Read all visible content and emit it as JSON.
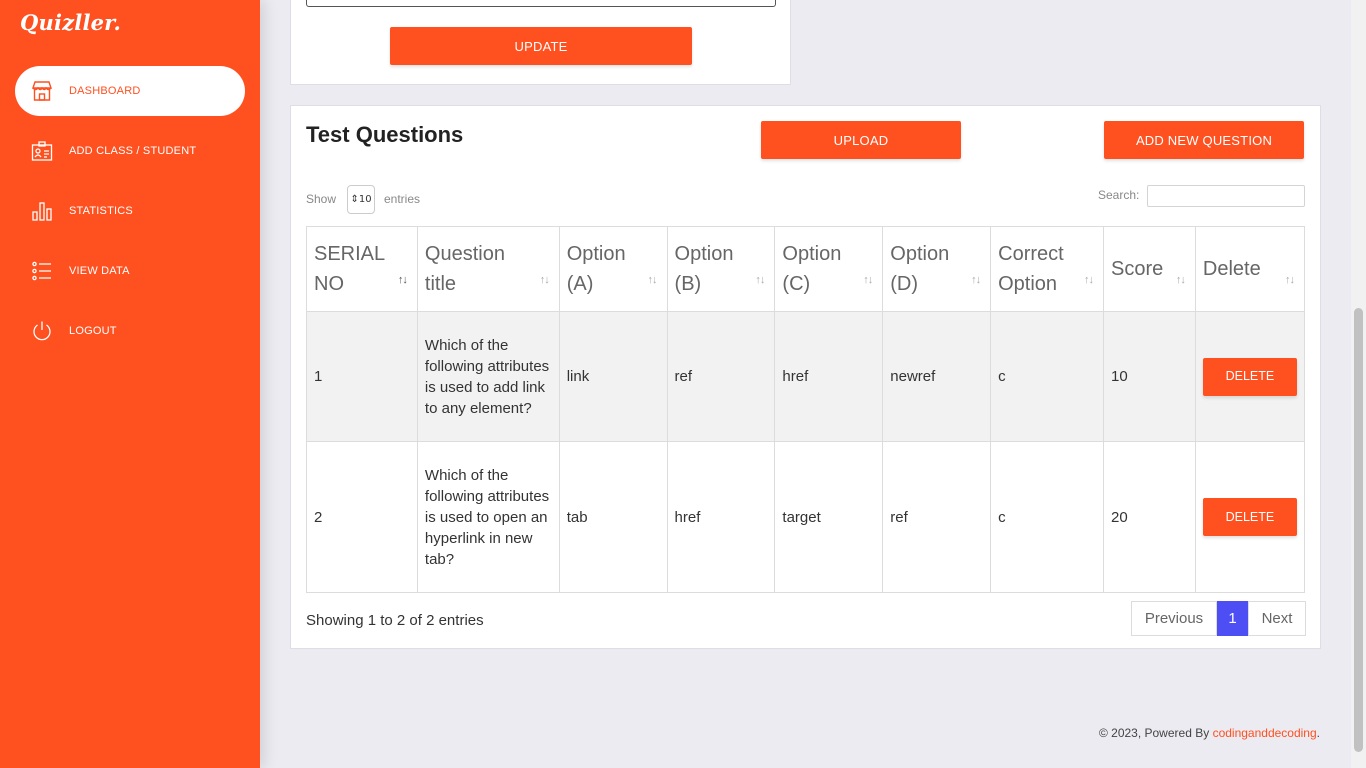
{
  "brand": {
    "logo_text": "Quizller.",
    "accent": "#ff5020"
  },
  "sidebar": {
    "items": [
      {
        "label": "DASHBOARD",
        "icon": "store-icon",
        "active": true
      },
      {
        "label": "ADD CLASS / STUDENT",
        "icon": "id-card-icon",
        "active": false
      },
      {
        "label": "STATISTICS",
        "icon": "bar-chart-icon",
        "active": false
      },
      {
        "label": "VIEW DATA",
        "icon": "list-icon",
        "active": false
      },
      {
        "label": "LOGOUT",
        "icon": "power-icon",
        "active": false
      }
    ]
  },
  "update_card": {
    "button_label": "UPDATE"
  },
  "questions_card": {
    "title": "Test Questions",
    "upload_label": "UPLOAD",
    "add_label": "ADD NEW QUESTION",
    "show_label": "Show",
    "entries_label": "entries",
    "page_length": "10",
    "search_label": "Search:",
    "search_value": "",
    "columns": [
      "SERIAL NO",
      "Question title",
      "Option (A)",
      "Option (B)",
      "Option (C)",
      "Option (D)",
      "Correct Option",
      "Score",
      "Delete"
    ],
    "rows": [
      {
        "serial": "1",
        "question": "Which of the following attributes is used to add link to any element?",
        "a": "link",
        "b": "ref",
        "c": "href",
        "d": "newref",
        "correct": "c",
        "score": "10",
        "delete_label": "DELETE"
      },
      {
        "serial": "2",
        "question": "Which of the following attributes is used to open an hyperlink in new tab?",
        "a": "tab",
        "b": "href",
        "c": "target",
        "d": "ref",
        "correct": "c",
        "score": "20",
        "delete_label": "DELETE"
      }
    ],
    "info": "Showing 1 to 2 of 2 entries",
    "pagination": {
      "previous": "Previous",
      "current": "1",
      "next": "Next"
    }
  },
  "footer": {
    "text": "© 2023, Powered By",
    "link": "codinganddecoding",
    "suffix": "."
  }
}
